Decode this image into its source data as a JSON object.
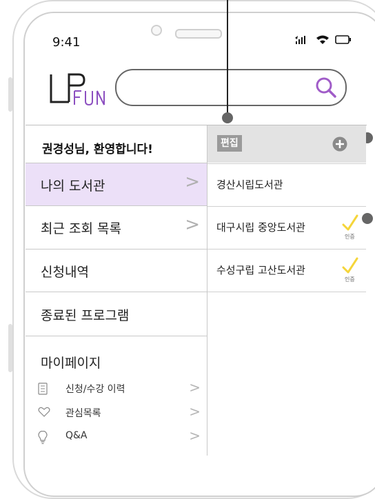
{
  "status_bar": {
    "time": "9:41"
  },
  "search": {
    "placeholder": ""
  },
  "greeting": "권경성님, 환영합니다!",
  "menu": [
    {
      "label": "나의 도서관",
      "active": true,
      "chevron": true
    },
    {
      "label": "최근 조회 목록",
      "active": false,
      "chevron": true
    },
    {
      "label": "신청내역",
      "active": false,
      "chevron": false
    },
    {
      "label": "종료된 프로그램",
      "active": false,
      "chevron": false
    }
  ],
  "mypage": {
    "title": "마이페이지",
    "items": [
      {
        "label": "신청/수강 이력",
        "icon": "document-list-icon"
      },
      {
        "label": "관심목록",
        "icon": "heart-icon"
      },
      {
        "label": "Q&A",
        "icon": "lightbulb-icon"
      }
    ]
  },
  "right_panel": {
    "edit_label": "편집",
    "libraries": [
      {
        "name": "경산시립도서관",
        "certified": false
      },
      {
        "name": "대구시립 중앙도서관",
        "certified": true
      },
      {
        "name": "수성구립 고산도서관",
        "certified": true
      }
    ],
    "cert_label": "인증"
  },
  "colors": {
    "active_menu": "#ece0f8",
    "check": "#f5d53a",
    "search_icon": "#a05cc8"
  }
}
